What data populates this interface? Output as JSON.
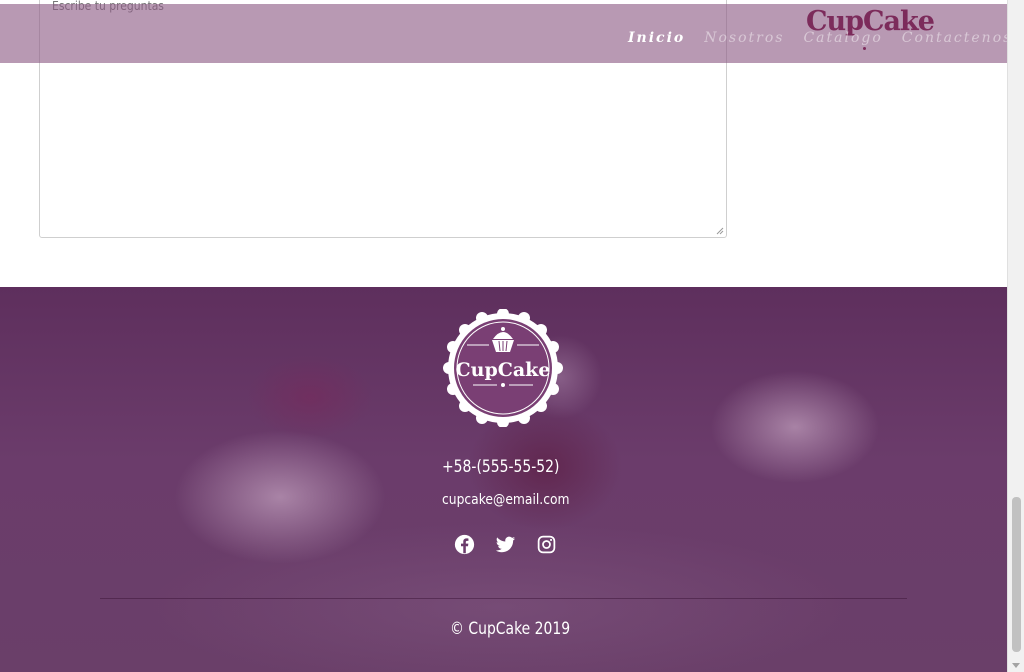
{
  "contact_form": {
    "question_placeholder": "Escribe tu preguntas"
  },
  "header": {
    "logo": "CupCake",
    "nav": [
      {
        "label": "Inicio",
        "active": true
      },
      {
        "label": "Nosotros",
        "active": false
      },
      {
        "label": "Catalogo",
        "active": false
      },
      {
        "label": "Contactenos",
        "active": false
      }
    ],
    "bar_color": "#8d5a84",
    "logo_color": "#7c2b5b"
  },
  "footer": {
    "badge_text": "CupCake",
    "phone": "+58-(555-55-52)",
    "email": "cupcake@email.com",
    "social": [
      {
        "name": "facebook-icon"
      },
      {
        "name": "twitter-icon"
      },
      {
        "name": "instagram-icon"
      }
    ],
    "copyright": "© CupCake 2019",
    "overlay_color": "#6b3c6b"
  },
  "scrollbar": {
    "position": 0.95
  }
}
